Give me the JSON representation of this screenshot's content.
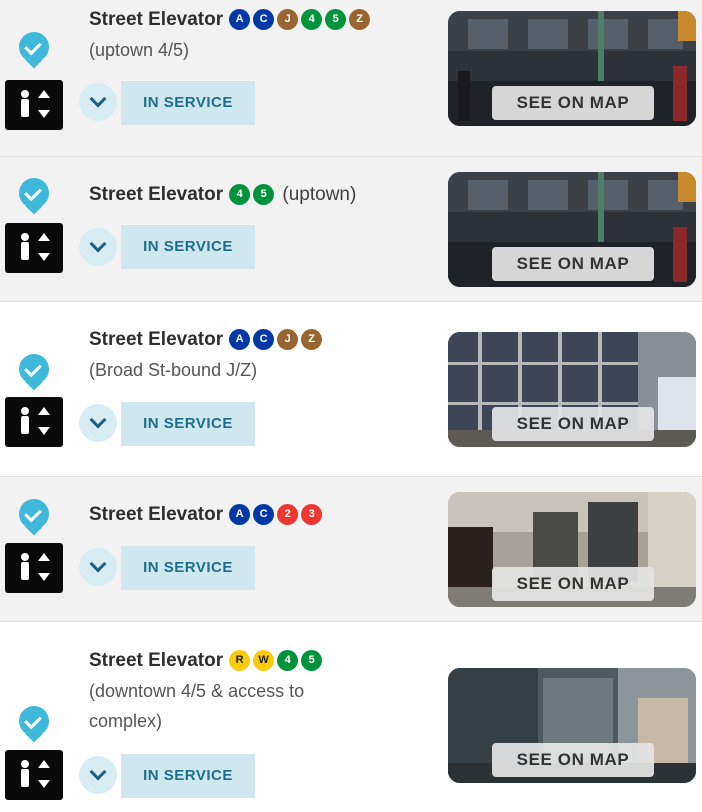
{
  "colors": {
    "line_ace": "#0039a6",
    "line_jz": "#996633",
    "line_456": "#00933c",
    "line_23": "#ee352e",
    "line_nqrw": "#fccc0a",
    "status_check": "#3fb8d9",
    "status_pill_bg": "#cfe8f0",
    "status_pill_text": "#1d6d8c"
  },
  "elevators": [
    {
      "title": "Street Elevator",
      "lines": [
        "A",
        "C",
        "J",
        "4",
        "5",
        "Z"
      ],
      "inline_note": "",
      "note_lines": [
        "(uptown 4/5)"
      ],
      "status": "IN SERVICE",
      "map_label": "SEE ON MAP",
      "status_icon": "check-pin-icon",
      "type_icon": "elevator-icon",
      "expand_icon": "chevron-down-icon"
    },
    {
      "title": "Street Elevator",
      "lines": [
        "4",
        "5"
      ],
      "inline_note": "(uptown)",
      "note_lines": [],
      "status": "IN SERVICE",
      "map_label": "SEE ON MAP",
      "status_icon": "check-pin-icon",
      "type_icon": "elevator-icon",
      "expand_icon": "chevron-down-icon"
    },
    {
      "title": "Street Elevator",
      "lines": [
        "A",
        "C",
        "J",
        "Z"
      ],
      "inline_note": "",
      "note_lines": [
        "(Broad St-bound J/Z)"
      ],
      "status": "IN SERVICE",
      "map_label": "SEE ON MAP",
      "status_icon": "check-pin-icon",
      "type_icon": "elevator-icon",
      "expand_icon": "chevron-down-icon"
    },
    {
      "title": "Street Elevator",
      "lines": [
        "A",
        "C",
        "2",
        "3"
      ],
      "inline_note": "",
      "note_lines": [],
      "status": "IN SERVICE",
      "map_label": "SEE ON MAP",
      "status_icon": "check-pin-icon",
      "type_icon": "elevator-icon",
      "expand_icon": "chevron-down-icon"
    },
    {
      "title": "Street Elevator",
      "lines": [
        "R",
        "W",
        "4",
        "5"
      ],
      "inline_note": "",
      "note_lines": [
        "(downtown 4/5 & access to",
        "complex)"
      ],
      "status": "IN SERVICE",
      "map_label": "SEE ON MAP",
      "status_icon": "check-pin-icon",
      "type_icon": "elevator-icon",
      "expand_icon": "chevron-down-icon"
    }
  ]
}
